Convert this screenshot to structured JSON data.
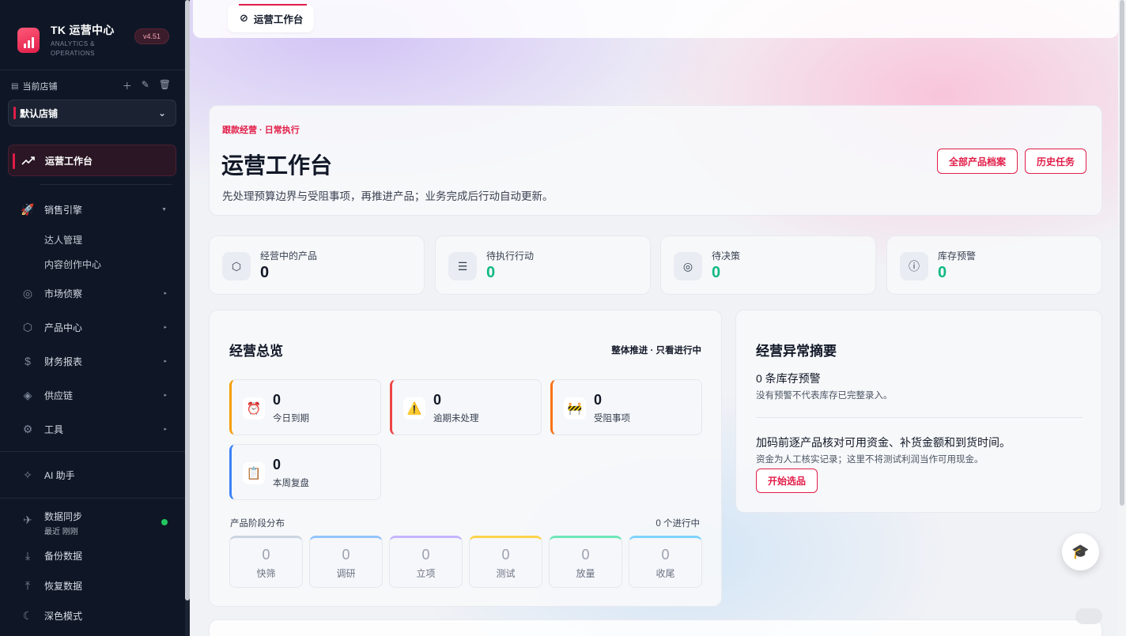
{
  "sidebar": {
    "brand_title": "TK 运营中心",
    "brand_sub_1": "ANALYTICS &",
    "brand_sub_2": "OPERATIONS",
    "version": "v4.51",
    "store_label": "当前店铺",
    "store_selected": "默认店铺",
    "active_nav": "运营工作台",
    "nav": [
      {
        "label": "销售引擎",
        "icon": "rocket-icon"
      },
      {
        "label": "达人管理"
      },
      {
        "label": "内容创作中心"
      },
      {
        "label": "市场侦察",
        "icon": "radar-icon"
      },
      {
        "label": "产品中心",
        "icon": "box-icon"
      },
      {
        "label": "财务报表",
        "icon": "dollar-icon"
      },
      {
        "label": "供应链",
        "icon": "layers-icon"
      },
      {
        "label": "工具",
        "icon": "gear-icon"
      }
    ],
    "ai": "AI 助手",
    "sync_title": "数据同步",
    "sync_sub": "最近 刚刚",
    "backup": "备份数据",
    "restore": "恢复数据",
    "dark_mode": "深色模式"
  },
  "header": {
    "tab_label": "运营工作台"
  },
  "hero": {
    "kicker": "跟款经营 · 日常执行",
    "title": "运营工作台",
    "desc": "先处理预算边界与受阻事项，再推进产品；业务完成后行动自动更新。",
    "btn_all": "全部产品档案",
    "btn_history": "历史任务"
  },
  "stats": [
    {
      "label": "经营中的产品",
      "value": "0"
    },
    {
      "label": "待执行行动",
      "value": "0"
    },
    {
      "label": "待决策",
      "value": "0"
    },
    {
      "label": "库存预警",
      "value": "0"
    }
  ],
  "overview": {
    "title": "经营总览",
    "right": "整体推进 · 只看进行中",
    "tiles": [
      {
        "value": "0",
        "label": "今日到期",
        "emoji": "⏰",
        "color": "#f59e0b"
      },
      {
        "value": "0",
        "label": "逾期未处理",
        "emoji": "⚠️",
        "color": "#ef4444"
      },
      {
        "value": "0",
        "label": "受阻事项",
        "emoji": "🚧",
        "color": "#f97316"
      },
      {
        "value": "0",
        "label": "本周复盘",
        "emoji": "📋",
        "color": "#3b82f6"
      }
    ],
    "stage_label": "产品阶段分布",
    "stage_right": "0 个进行中",
    "stages": [
      {
        "value": "0",
        "label": "快筛",
        "color": "#cbd5e1"
      },
      {
        "value": "0",
        "label": "调研",
        "color": "#93c5fd"
      },
      {
        "value": "0",
        "label": "立项",
        "color": "#c4b5fd"
      },
      {
        "value": "0",
        "label": "测试",
        "color": "#fcd34d"
      },
      {
        "value": "0",
        "label": "放量",
        "color": "#6ee7b7"
      },
      {
        "value": "0",
        "label": "收尾",
        "color": "#7dd3fc"
      }
    ]
  },
  "alerts": {
    "title": "经营异常摘要",
    "h1": "0 条库存预警",
    "s1": "没有预警不代表库存已完整录入。",
    "h2": "加码前逐产品核对可用资金、补货金额和到货时间。",
    "s2": "资金为人工核实记录；这里不将测试利润当作可用现金。",
    "btn": "开始选品"
  },
  "colors": {
    "accent": "#e11d48",
    "sidebar_bg": "#0f1726",
    "success": "#10b981"
  }
}
